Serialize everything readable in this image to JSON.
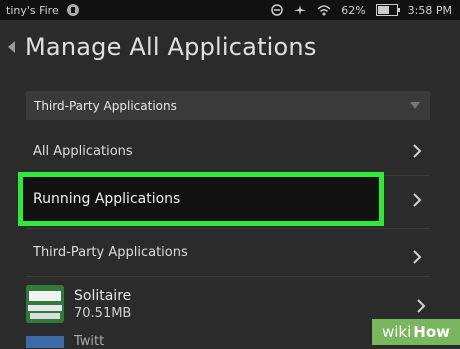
{
  "status_bar": {
    "device_name": "tiny's Fire",
    "battery": "62%",
    "battery_level": 0.62,
    "time": "3:58 PM"
  },
  "header": {
    "title": "Manage All Applications"
  },
  "filter": {
    "selected": "Third-Party Applications"
  },
  "menu_items": [
    {
      "label": "All Applications"
    },
    {
      "label": "Running Applications",
      "highlighted": true
    },
    {
      "label": "Third-Party Applications"
    }
  ],
  "apps": [
    {
      "name": "Solitaire",
      "size": "70.51MB"
    },
    {
      "name": "Twitt"
    }
  ],
  "watermark": {
    "part1": "wiki",
    "part2": "How"
  },
  "colors": {
    "highlight_border": "#2ee83a",
    "background": "#2b2b2b",
    "watermark_bg": "#7ab65d"
  }
}
